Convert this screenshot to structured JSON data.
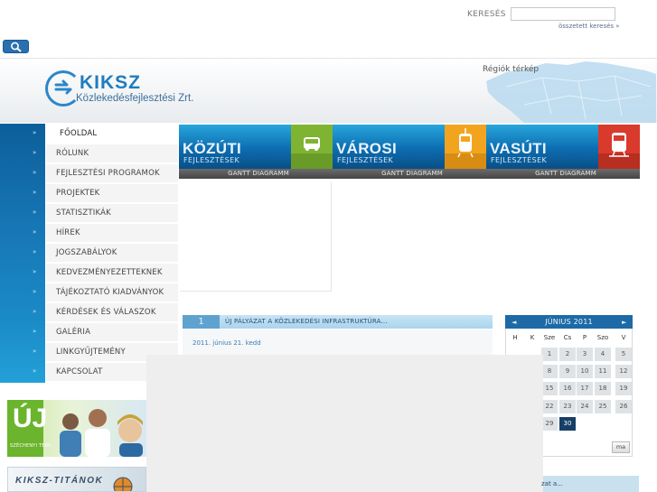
{
  "search": {
    "label": "KERESÉS",
    "placeholder": "",
    "advanced_link": "összetett keresés »"
  },
  "brand": {
    "name": "KIKSZ",
    "subtitle": "Közlekedésfejlesztési Zrt."
  },
  "header": {
    "region_map_link": "Régiók térkép"
  },
  "nav": {
    "items": [
      {
        "label": "FŐOLDAL"
      },
      {
        "label": "RÓLUNK"
      },
      {
        "label": "FEJLESZTÉSI PROGRAMOK"
      },
      {
        "label": "PROJEKTEK"
      },
      {
        "label": "STATISZTIKÁK"
      },
      {
        "label": "HÍREK"
      },
      {
        "label": "JOGSZABÁLYOK"
      },
      {
        "label": "KEDVEZMÉNYEZETTEKNEK"
      },
      {
        "label": "TÁJÉKOZTATÓ KIADVÁNYOK"
      },
      {
        "label": "KÉRDÉSEK ÉS VÁLASZOK"
      },
      {
        "label": "GALÉRIA"
      },
      {
        "label": "LINKGYŰJTEMÉNY"
      },
      {
        "label": "KAPCSOLAT"
      }
    ],
    "arrow": "»",
    "active_index": 0
  },
  "tiles": [
    {
      "title": "KÖZÚTI",
      "subtitle": "FEJLESZTÉSEK",
      "gantt": "GANTT DIAGRAMM",
      "icon": "car-icon",
      "icon_bg": "#7fb433"
    },
    {
      "title": "VÁROSI",
      "subtitle": "FEJLESZTÉSEK",
      "gantt": "GANTT DIAGRAMM",
      "icon": "tram-icon",
      "icon_bg": "#f3a41f"
    },
    {
      "title": "VASÚTI",
      "subtitle": "FEJLESZTÉSEK",
      "gantt": "GANTT DIAGRAMM",
      "icon": "train-icon",
      "icon_bg": "#d93a2b"
    }
  ],
  "news": {
    "number": "1",
    "title": "ÚJ PÁLYÁZAT A KÖZLEKEDÉSI INFRASTRUKTÚRA...",
    "date": "2011. június 21. kedd"
  },
  "calendar": {
    "prev": "◄",
    "next": "►",
    "month": "JÚNIUS 2011",
    "weekdays": [
      "H",
      "K",
      "Sze",
      "Cs",
      "P",
      "Szo",
      "V"
    ],
    "days": [
      {
        "day": "1"
      },
      {
        "day": "2"
      },
      {
        "day": "3"
      },
      {
        "day": "4"
      },
      {
        "day": "5"
      },
      {
        "day": "8"
      },
      {
        "day": "9"
      },
      {
        "day": "10"
      },
      {
        "day": "11"
      },
      {
        "day": "12"
      },
      {
        "day": "15"
      },
      {
        "day": "16"
      },
      {
        "day": "17"
      },
      {
        "day": "18"
      },
      {
        "day": "19"
      },
      {
        "day": "22"
      },
      {
        "day": "23"
      },
      {
        "day": "24"
      },
      {
        "day": "25"
      },
      {
        "day": "26"
      },
      {
        "day": "29"
      },
      {
        "day": "30"
      }
    ],
    "today": "30",
    "button": "ma"
  },
  "promos": {
    "new_big": "ÚJ",
    "new_small": "SZÉCHENYI TERV",
    "titans": "KIKSZ-TITÁNOK"
  },
  "overlay": {
    "more_text": "zat a..."
  }
}
